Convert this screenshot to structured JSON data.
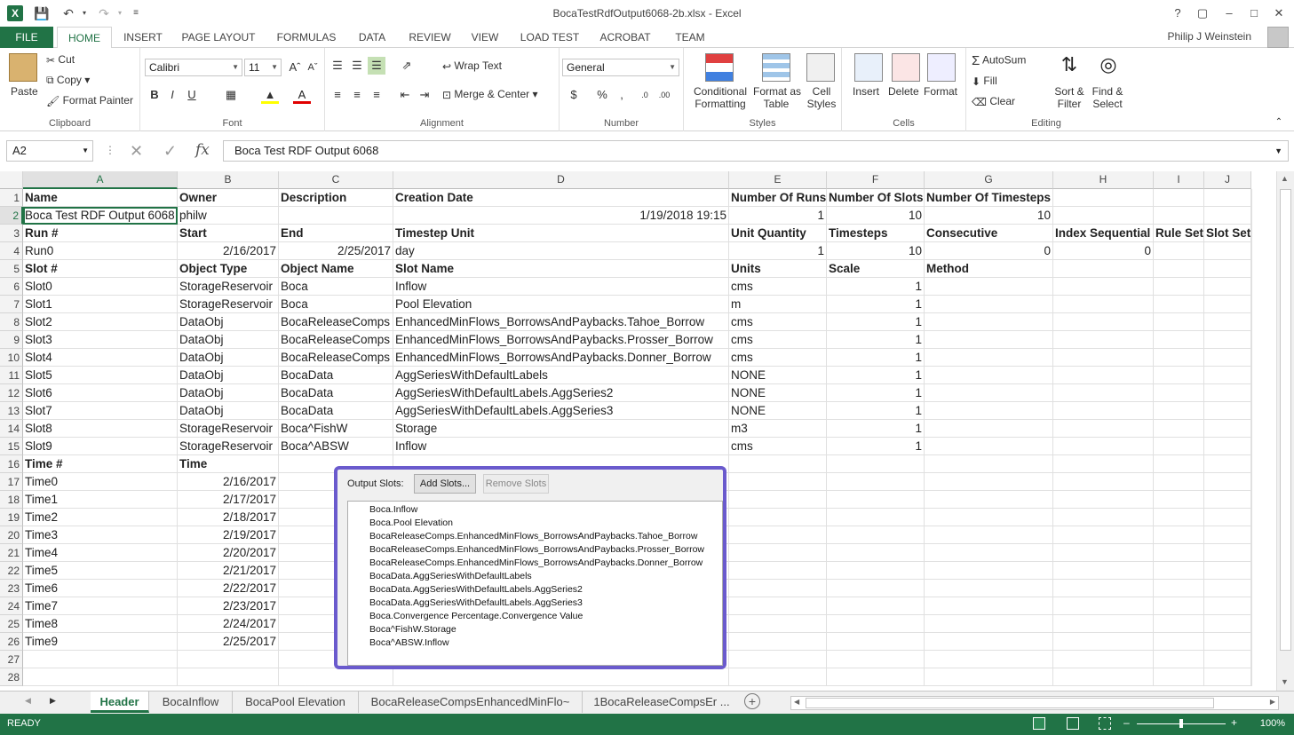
{
  "titlebar": {
    "title": "BocaTestRdfOutput6068-2b.xlsx - Excel",
    "help": "?",
    "user": "Philip J Weinstein"
  },
  "ribbon_tabs": [
    "FILE",
    "HOME",
    "INSERT",
    "PAGE LAYOUT",
    "FORMULAS",
    "DATA",
    "REVIEW",
    "VIEW",
    "LOAD TEST",
    "ACROBAT",
    "TEAM"
  ],
  "clipboard": {
    "paste": "Paste",
    "cut": "Cut",
    "copy": "Copy",
    "format_painter": "Format Painter",
    "label": "Clipboard"
  },
  "font": {
    "family": "Calibri",
    "size": "11",
    "label": "Font"
  },
  "alignment": {
    "wrap": "Wrap Text",
    "merge": "Merge & Center",
    "label": "Alignment"
  },
  "number": {
    "format": "General",
    "label": "Number"
  },
  "styles": {
    "conditional": "Conditional",
    "conditional2": "Formatting",
    "format_table": "Format as",
    "format_table2": "Table",
    "cell_styles": "Cell",
    "cell_styles2": "Styles",
    "label": "Styles"
  },
  "cells": {
    "insert": "Insert",
    "delete": "Delete",
    "format": "Format",
    "label": "Cells"
  },
  "editing": {
    "autosum": "AutoSum",
    "fill": "Fill",
    "clear": "Clear",
    "sort": "Sort &",
    "sort2": "Filter",
    "find": "Find &",
    "find2": "Select",
    "label": "Editing"
  },
  "formula_bar": {
    "name_box": "A2",
    "fx": "fx",
    "value": "Boca Test RDF Output 6068"
  },
  "columns": [
    "A",
    "B",
    "C",
    "D",
    "E",
    "F",
    "G",
    "H",
    "I",
    "J"
  ],
  "rows": [
    [
      "Name",
      "Owner",
      "Description",
      "Creation Date",
      "Number Of Runs",
      "Number Of Slots",
      "Number Of Timesteps",
      "",
      "",
      ""
    ],
    [
      "Boca Test RDF Output 6068",
      "philw",
      "",
      "1/19/2018 19:15",
      "1",
      "10",
      "10",
      "",
      "",
      ""
    ],
    [
      "Run #",
      "Start",
      "End",
      "Timestep Unit",
      "Unit Quantity",
      "Timesteps",
      "Consecutive",
      "Index Sequential",
      "Rule Set",
      "Slot Set"
    ],
    [
      "Run0",
      "2/16/2017",
      "2/25/2017",
      "day",
      "1",
      "10",
      "0",
      "0",
      "",
      ""
    ],
    [
      "Slot #",
      "Object Type",
      "Object Name",
      "Slot Name",
      "Units",
      "Scale",
      "Method",
      "",
      "",
      ""
    ],
    [
      "Slot0",
      "StorageReservoir",
      "Boca",
      "Inflow",
      "cms",
      "1",
      "",
      "",
      "",
      ""
    ],
    [
      "Slot1",
      "StorageReservoir",
      "Boca",
      "Pool Elevation",
      "m",
      "1",
      "",
      "",
      "",
      ""
    ],
    [
      "Slot2",
      "DataObj",
      "BocaReleaseComps",
      "EnhancedMinFlows_BorrowsAndPaybacks.Tahoe_Borrow",
      "cms",
      "1",
      "",
      "",
      "",
      ""
    ],
    [
      "Slot3",
      "DataObj",
      "BocaReleaseComps",
      "EnhancedMinFlows_BorrowsAndPaybacks.Prosser_Borrow",
      "cms",
      "1",
      "",
      "",
      "",
      ""
    ],
    [
      "Slot4",
      "DataObj",
      "BocaReleaseComps",
      "EnhancedMinFlows_BorrowsAndPaybacks.Donner_Borrow",
      "cms",
      "1",
      "",
      "",
      "",
      ""
    ],
    [
      "Slot5",
      "DataObj",
      "BocaData",
      "AggSeriesWithDefaultLabels",
      "NONE",
      "1",
      "",
      "",
      "",
      ""
    ],
    [
      "Slot6",
      "DataObj",
      "BocaData",
      "AggSeriesWithDefaultLabels.AggSeries2",
      "NONE",
      "1",
      "",
      "",
      "",
      ""
    ],
    [
      "Slot7",
      "DataObj",
      "BocaData",
      "AggSeriesWithDefaultLabels.AggSeries3",
      "NONE",
      "1",
      "",
      "",
      "",
      ""
    ],
    [
      "Slot8",
      "StorageReservoir",
      "Boca^FishW",
      "Storage",
      "m3",
      "1",
      "",
      "",
      "",
      ""
    ],
    [
      "Slot9",
      "StorageReservoir",
      "Boca^ABSW",
      "Inflow",
      "cms",
      "1",
      "",
      "",
      "",
      ""
    ],
    [
      "Time #",
      "Time",
      "",
      "",
      "",
      "",
      "",
      "",
      "",
      ""
    ],
    [
      "Time0",
      "2/16/2017",
      "",
      "",
      "",
      "",
      "",
      "",
      "",
      ""
    ],
    [
      "Time1",
      "2/17/2017",
      "",
      "",
      "",
      "",
      "",
      "",
      "",
      ""
    ],
    [
      "Time2",
      "2/18/2017",
      "",
      "",
      "",
      "",
      "",
      "",
      "",
      ""
    ],
    [
      "Time3",
      "2/19/2017",
      "",
      "",
      "",
      "",
      "",
      "",
      "",
      ""
    ],
    [
      "Time4",
      "2/20/2017",
      "",
      "",
      "",
      "",
      "",
      "",
      "",
      ""
    ],
    [
      "Time5",
      "2/21/2017",
      "",
      "",
      "",
      "",
      "",
      "",
      "",
      ""
    ],
    [
      "Time6",
      "2/22/2017",
      "",
      "",
      "",
      "",
      "",
      "",
      "",
      ""
    ],
    [
      "Time7",
      "2/23/2017",
      "",
      "",
      "",
      "",
      "",
      "",
      "",
      ""
    ],
    [
      "Time8",
      "2/24/2017",
      "",
      "",
      "",
      "",
      "",
      "",
      "",
      ""
    ],
    [
      "Time9",
      "2/25/2017",
      "",
      "",
      "",
      "",
      "",
      "",
      "",
      ""
    ],
    [
      "",
      "",
      "",
      "",
      "",
      "",
      "",
      "",
      "",
      ""
    ],
    [
      "",
      "",
      "",
      "",
      "",
      "",
      "",
      "",
      "",
      ""
    ]
  ],
  "bold_rows": [
    1,
    3,
    5,
    16
  ],
  "sheet_tabs": [
    "Header",
    "BocaInflow",
    "BocaPool Elevation",
    "BocaReleaseCompsEnhancedMinFlo~",
    "1BocaReleaseCompsEr ..."
  ],
  "status": {
    "ready": "READY",
    "zoom": "100%"
  },
  "dialog": {
    "label": "Output Slots:",
    "add": "Add Slots...",
    "remove": "Remove Slots",
    "items": [
      "Boca.Inflow",
      "Boca.Pool Elevation",
      "BocaReleaseComps.EnhancedMinFlows_BorrowsAndPaybacks.Tahoe_Borrow",
      "BocaReleaseComps.EnhancedMinFlows_BorrowsAndPaybacks.Prosser_Borrow",
      "BocaReleaseComps.EnhancedMinFlows_BorrowsAndPaybacks.Donner_Borrow",
      "BocaData.AggSeriesWithDefaultLabels",
      "BocaData.AggSeriesWithDefaultLabels.AggSeries2",
      "BocaData.AggSeriesWithDefaultLabels.AggSeries3",
      "Boca.Convergence Percentage.Convergence Value",
      "Boca^FishW.Storage",
      "Boca^ABSW.Inflow"
    ]
  },
  "colors": {
    "accent": "#217346",
    "dialog_border": "#6a5acd"
  }
}
